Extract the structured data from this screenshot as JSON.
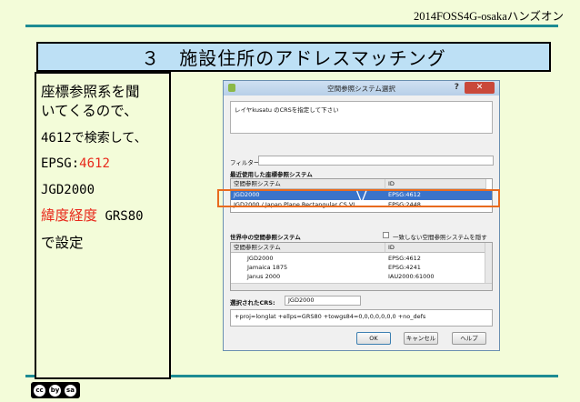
{
  "header": {
    "event": "2014FOSS4G-osakaハンズオン"
  },
  "slide": {
    "title": "３　施設住所のアドレスマッチング",
    "side_lines": [
      {
        "text": "座標参照系を聞"
      },
      {
        "text": "いてくるので、"
      },
      {
        "text": "4612で検索して、"
      },
      {
        "prefix": "EPSG:",
        "value": "4612"
      },
      {
        "text": "JGD2000"
      },
      {
        "red": "緯度経度",
        "rest": " GRS80"
      },
      {
        "text": "で設定"
      }
    ],
    "license_icons": [
      "cc",
      "by",
      "sa"
    ]
  },
  "dialog": {
    "title": "空間参照システム選択",
    "help": "?",
    "close": "✕",
    "info": "レイヤkusatu のCRSを指定して下さい",
    "filter_label": "フィルター",
    "recent_label": "最近使用した座標参照システム",
    "recent_columns": [
      "空間参照システム",
      "ID"
    ],
    "recent_rows": [
      {
        "name": "JGD2000",
        "id": "EPSG:4612",
        "selected": true
      },
      {
        "name": "JGD2000 / Japan Plane Rectangular CS VI",
        "id": "EPSG:2448",
        "selected": false
      }
    ],
    "world_label": "世界中の空間参照システム",
    "hide_label": "一致しない空間参照システムを隠す",
    "world_columns": [
      "空間参照システム",
      "ID"
    ],
    "world_rows": [
      {
        "name": "JGD2000",
        "id": "EPSG:4612"
      },
      {
        "name": "Jamaica 1875",
        "id": "EPSG:4241"
      },
      {
        "name": "Janus 2000",
        "id": "IAU2000:61000"
      }
    ],
    "selected_label": "選択されたCRS:",
    "selected_value": "JGD2000",
    "proj_string": "+proj=longlat +ellps=GRS80 +towgs84=0,0,0,0,0,0,0 +no_defs",
    "buttons": {
      "ok": "OK",
      "cancel": "キャンセル",
      "help": "ヘルプ"
    }
  }
}
